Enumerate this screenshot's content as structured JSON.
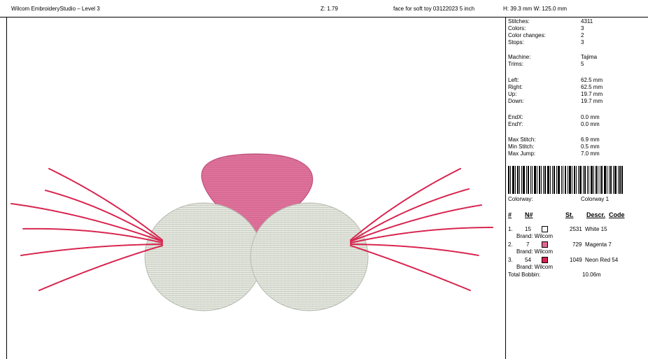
{
  "header": {
    "app_title": "Wilcom EmbroideryStudio – Level 3",
    "zoom": "Z: 1.79",
    "design_name": "face for soft toy 03122023 5 inch",
    "dimensions": "H: 39.3 mm   W: 125.0 mm"
  },
  "stats": [
    {
      "label": "Stitches:",
      "value": "4311"
    },
    {
      "label": "Colors:",
      "value": "3"
    },
    {
      "label": "Color changes:",
      "value": "2"
    },
    {
      "label": "Stops:",
      "value": "3"
    },
    {
      "label": "Machine:",
      "value": "Tajima"
    },
    {
      "label": "Trims:",
      "value": "5"
    },
    {
      "label": "Left:",
      "value": "62.5 mm"
    },
    {
      "label": "Right:",
      "value": "62.5 mm"
    },
    {
      "label": "Up:",
      "value": "19.7 mm"
    },
    {
      "label": "Down:",
      "value": "19.7 mm"
    },
    {
      "label": "EndX:",
      "value": "0.0 mm"
    },
    {
      "label": "EndY:",
      "value": "0.0 mm"
    },
    {
      "label": "Max Stitch:",
      "value": "6.9 mm"
    },
    {
      "label": "Min Stitch:",
      "value": "0.5 mm"
    },
    {
      "label": "Max Jump:",
      "value": "7.0 mm"
    }
  ],
  "colorway": {
    "label": "Colorway:",
    "value": "Colorway 1"
  },
  "color_table": {
    "headers": {
      "num": "#",
      "needle": "N#",
      "stitches": "St.",
      "descr": "Descr.",
      "code": "Code"
    },
    "rows": [
      {
        "num": "1.",
        "needle": "15",
        "stitches": "2531",
        "descr": "White 15",
        "brand": "Brand: Wilcom",
        "color": "#ffffff"
      },
      {
        "num": "2.",
        "needle": "7",
        "stitches": "729",
        "descr": "Magenta 7",
        "brand": "Brand: Wilcom",
        "color": "#e0688f"
      },
      {
        "num": "3.",
        "needle": "54",
        "stitches": "1049",
        "descr": "Neon Red 54",
        "brand": "Brand: Wilcom",
        "color": "#d8234e"
      }
    ],
    "total_label": "Total Bobbin:",
    "total_value": "10.06m"
  }
}
